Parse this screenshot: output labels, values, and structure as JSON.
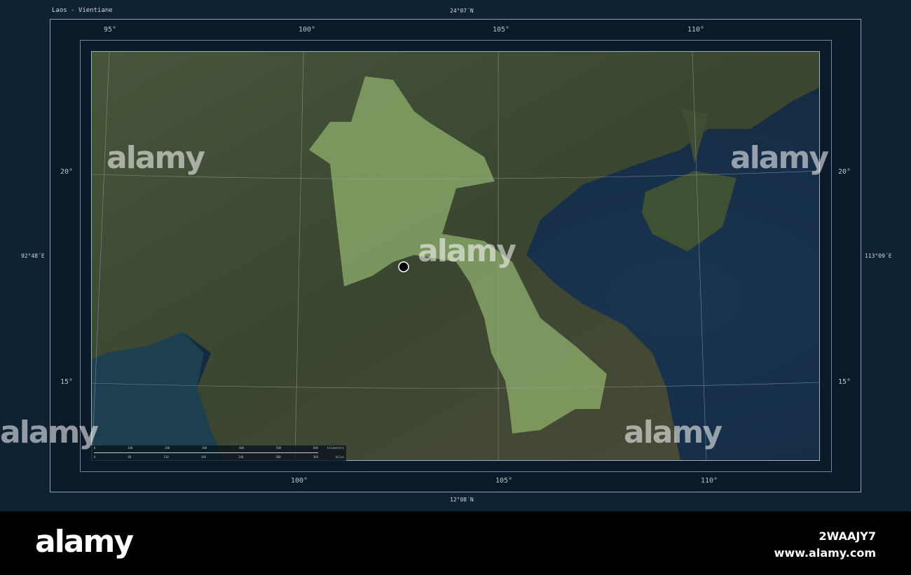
{
  "title": "Laos - Vientiane",
  "coords": {
    "north": "24°07´N",
    "south": "12°08´N",
    "west": "92°48´E",
    "east": "113°09´E"
  },
  "top_ticks": [
    "95°",
    "100°",
    "105°",
    "110°"
  ],
  "bottom_ticks": [
    "100°",
    "105°",
    "110°"
  ],
  "lat_ticks": [
    "20°",
    "15°"
  ],
  "scale": {
    "km": [
      "0",
      "100",
      "200",
      "300",
      "400",
      "500",
      "600"
    ],
    "km_unit": "kilometers",
    "mi": [
      "0",
      "60",
      "120",
      "180",
      "240",
      "300",
      "360"
    ],
    "mi_unit": "miles"
  },
  "watermark": "alamy",
  "footer": {
    "logo": "alamy",
    "image_id": "2WAAJY7",
    "site": "www.alamy.com"
  },
  "colors": {
    "sea": "#1c3450",
    "land": "#3d4a2e",
    "highlight": "#8fae6a"
  }
}
